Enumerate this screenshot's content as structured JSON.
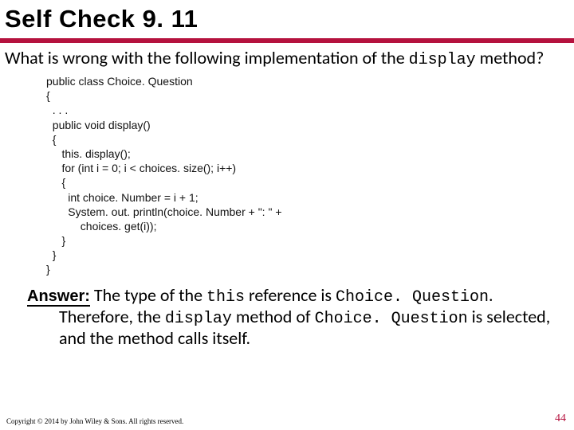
{
  "title": "Self Check 9. 11",
  "question_pre": "What is wrong with the following implementation of the ",
  "question_code": "display",
  "question_post": " method?",
  "code": "public class Choice. Question\n{\n  . . .\n  public void display()\n  {\n     this. display();\n     for (int i = 0; i < choices. size(); i++)\n     {\n       int choice. Number = i + 1;\n       System. out. println(choice. Number + \": \" +\n           choices. get(i));\n     }\n  }\n}",
  "answer_label": "Answer:",
  "answer_p1": " The type of the ",
  "answer_c1": "this",
  "answer_p2": " reference is ",
  "answer_c2": "Choice. Question",
  "answer_p3": ". Therefore, the ",
  "answer_c3": "display",
  "answer_p4": " method of ",
  "answer_c4": "Choice. Question",
  "answer_p5": " is selected, and the method calls itself.",
  "copyright": "Copyright © 2014 by John Wiley & Sons. All rights reserved.",
  "page_number": "44",
  "colors": {
    "accent": "#b5123e"
  }
}
